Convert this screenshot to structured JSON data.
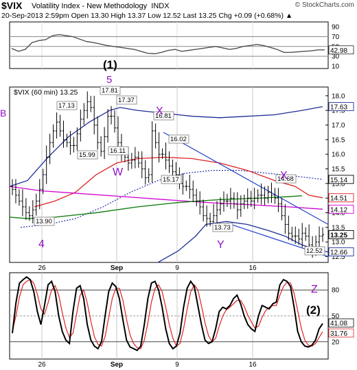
{
  "header": {
    "symbol": "$VIX",
    "name": "Volatility Index - New Methodology",
    "exchange": "INDX",
    "logo": "© StockCharts.com",
    "quote": "20-Sep-2013 2:59pm   Open 13.30   High 13.37   Low 12.52   Last 13.25   Chg +0.09 (+0.68%) ▲"
  },
  "colors": {
    "rsi_line": "#505050",
    "price_bar": "#000000",
    "upper_band": "#1e2d96",
    "red_ma": "#e02020",
    "magenta_ma": "#d000d0",
    "green_ma": "#188018",
    "dotted_ma": "#2030b0",
    "channel": "#2040d0",
    "stoch_k": "#000000",
    "stoch_d": "#e02020",
    "wave_label": "#9010c8"
  },
  "chart_data": [
    {
      "type": "line",
      "title": "RSI",
      "y_ticks": [
        10,
        30,
        50,
        70,
        90
      ],
      "ylim": [
        5,
        100
      ],
      "reference_lines": [
        30,
        50,
        70
      ],
      "series": [
        {
          "values": [
            46,
            40,
            44,
            58,
            62,
            64,
            72,
            74,
            72,
            70,
            65,
            60,
            58,
            55,
            52,
            50,
            48,
            46,
            44,
            40,
            36,
            35,
            38,
            42,
            44,
            40,
            42,
            44,
            46,
            48,
            50,
            47,
            44,
            46,
            50,
            52,
            54,
            52,
            48,
            44,
            38,
            38,
            39,
            40,
            41,
            43,
            42.98
          ]
        }
      ],
      "last_label": "42.98",
      "annotation": "(1)"
    },
    {
      "type": "line",
      "title": "$VIX (60 min) 13.25",
      "x_tick_labels": [
        "26",
        "Sep",
        "9",
        "16"
      ],
      "y_ticks": [
        12.5,
        13.0,
        13.5,
        14.0,
        14.5,
        15.0,
        15.5,
        16.0,
        16.5,
        17.0,
        17.5,
        18.0
      ],
      "ylim": [
        12.3,
        18.3
      ],
      "series": [
        {
          "values": [
            14.8,
            14.6,
            14.4,
            14.2,
            14.0,
            13.9,
            14.1,
            14.4,
            14.8,
            15.3,
            15.9,
            16.4,
            16.8,
            17.1,
            16.8,
            16.5,
            16.4,
            16.3,
            16.3,
            16.7,
            17.2,
            17.5,
            17.8,
            17.6,
            17.0,
            16.4,
            16.1,
            16.6,
            17.3,
            17.3,
            16.9,
            16.4,
            16.0,
            15.9,
            15.7,
            15.8,
            15.9,
            15.7,
            15.5,
            15.2,
            15.3,
            16.8,
            16.4,
            16.0,
            16.0,
            15.8,
            15.6,
            15.4,
            15.3,
            15.0,
            14.9,
            14.9,
            14.8,
            14.6,
            14.4,
            14.2,
            13.9,
            13.8,
            13.7,
            13.9,
            14.1,
            14.3,
            14.4,
            14.4,
            14.5,
            14.3,
            14.1,
            14.3,
            14.4,
            14.5,
            14.4,
            14.5,
            14.6,
            14.6,
            14.5,
            14.7,
            14.6,
            14.5,
            14.3,
            13.9,
            13.6,
            13.3,
            13.2,
            13.2,
            13.1,
            13.3,
            13.2,
            12.9,
            12.7,
            13.0,
            13.2,
            13.25
          ]
        }
      ],
      "price_labels": [
        "17.81",
        "17.13",
        "17.37",
        "15.99",
        "16.11",
        "16.81",
        "16.02",
        "15.17",
        "14.68",
        "13.90",
        "13.73",
        "12.52"
      ],
      "axis_labels": [
        "17.63",
        "15.14",
        "14.51",
        "14.12",
        "13.25",
        "12.66"
      ],
      "wave_labels": [
        "5",
        "X",
        "W",
        "X",
        "Y",
        "4",
        "Z"
      ]
    },
    {
      "type": "line",
      "title": "Stochastics",
      "x_tick_labels": [
        "26",
        "Sep",
        "9",
        "16"
      ],
      "y_ticks": [
        20,
        50,
        80
      ],
      "ylim": [
        0,
        100
      ],
      "reference_lines": [
        20,
        50,
        80
      ],
      "series": [
        {
          "values": [
            30,
            65,
            88,
            92,
            95,
            92,
            78,
            55,
            40,
            62,
            86,
            90,
            78,
            50,
            32,
            22,
            18,
            55,
            82,
            85,
            70,
            40,
            22,
            15,
            12,
            20,
            50,
            78,
            88,
            84,
            70,
            45,
            22,
            14,
            12,
            10,
            15,
            40,
            70,
            88,
            90,
            80,
            60,
            35,
            18,
            12,
            15,
            30,
            60,
            82,
            90,
            84,
            62,
            40,
            22,
            18,
            20,
            35,
            55,
            60,
            58,
            62,
            70,
            74,
            64,
            50,
            40,
            35,
            32,
            50,
            62,
            60,
            58,
            64,
            66,
            86,
            92,
            90,
            84,
            60,
            32,
            20,
            15,
            14,
            16,
            22,
            35,
            41.08
          ]
        },
        {
          "values": [
            32,
            50,
            72,
            86,
            90,
            92,
            88,
            75,
            58,
            52,
            65,
            80,
            85,
            74,
            54,
            36,
            25,
            30,
            52,
            74,
            80,
            65,
            44,
            26,
            17,
            15,
            26,
            48,
            70,
            82,
            82,
            68,
            46,
            28,
            18,
            13,
            12,
            22,
            42,
            66,
            82,
            86,
            78,
            60,
            40,
            24,
            15,
            18,
            35,
            58,
            78,
            86,
            80,
            62,
            42,
            27,
            20,
            24,
            38,
            50,
            57,
            60,
            64,
            68,
            68,
            61,
            51,
            43,
            36,
            38,
            48,
            56,
            60,
            62,
            62,
            74,
            84,
            89,
            88,
            76,
            56,
            36,
            22,
            16,
            15,
            18,
            25,
            31.76
          ]
        }
      ],
      "annotation": "(2)",
      "last_labels": [
        "41.08",
        "31.76"
      ]
    }
  ]
}
